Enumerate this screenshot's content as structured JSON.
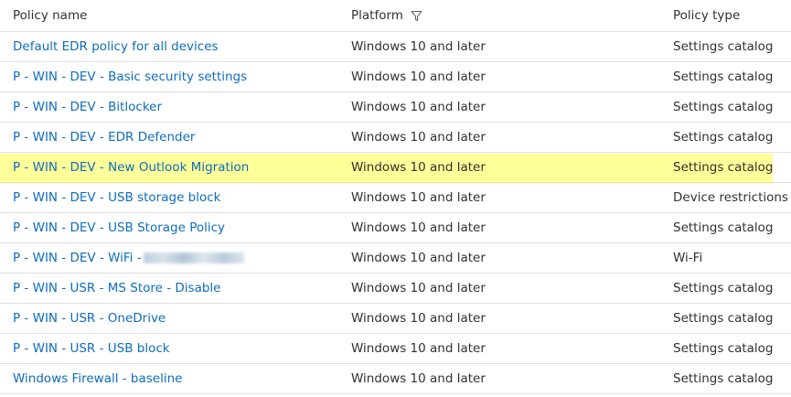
{
  "table": {
    "headers": {
      "policy_name": "Policy name",
      "platform": "Platform",
      "policy_type": "Policy type"
    },
    "filter_icon": "filter-icon",
    "highlight_color": "#ffff99",
    "link_color": "#0f6cbd",
    "rows": [
      {
        "name": "Default EDR policy for all devices",
        "platform": "Windows 10 and later",
        "type": "Settings catalog"
      },
      {
        "name": "P - WIN - DEV - Basic security settings",
        "platform": "Windows 10 and later",
        "type": "Settings catalog"
      },
      {
        "name": "P - WIN - DEV - Bitlocker",
        "platform": "Windows 10 and later",
        "type": "Settings catalog"
      },
      {
        "name": "P - WIN - DEV - EDR Defender",
        "platform": "Windows 10 and later",
        "type": "Settings catalog"
      },
      {
        "name": "P - WIN - DEV - New Outlook Migration",
        "platform": "Windows 10 and later",
        "type": "Settings catalog",
        "highlighted": true
      },
      {
        "name": "P - WIN - DEV - USB storage block",
        "platform": "Windows 10 and later",
        "type": "Device restrictions"
      },
      {
        "name": "P - WIN - DEV - USB Storage Policy",
        "platform": "Windows 10 and later",
        "type": "Settings catalog"
      },
      {
        "name": "P - WIN - DEV - WiFi -",
        "platform": "Windows 10 and later",
        "type": "Wi-Fi",
        "redacted_suffix": true
      },
      {
        "name": "P - WIN - USR - MS Store - Disable",
        "platform": "Windows 10 and later",
        "type": "Settings catalog"
      },
      {
        "name": "P - WIN - USR - OneDrive",
        "platform": "Windows 10 and later",
        "type": "Settings catalog"
      },
      {
        "name": "P - WIN - USR - USB block",
        "platform": "Windows 10 and later",
        "type": "Settings catalog"
      },
      {
        "name": "Windows Firewall - baseline",
        "platform": "Windows 10 and later",
        "type": "Settings catalog"
      }
    ]
  }
}
